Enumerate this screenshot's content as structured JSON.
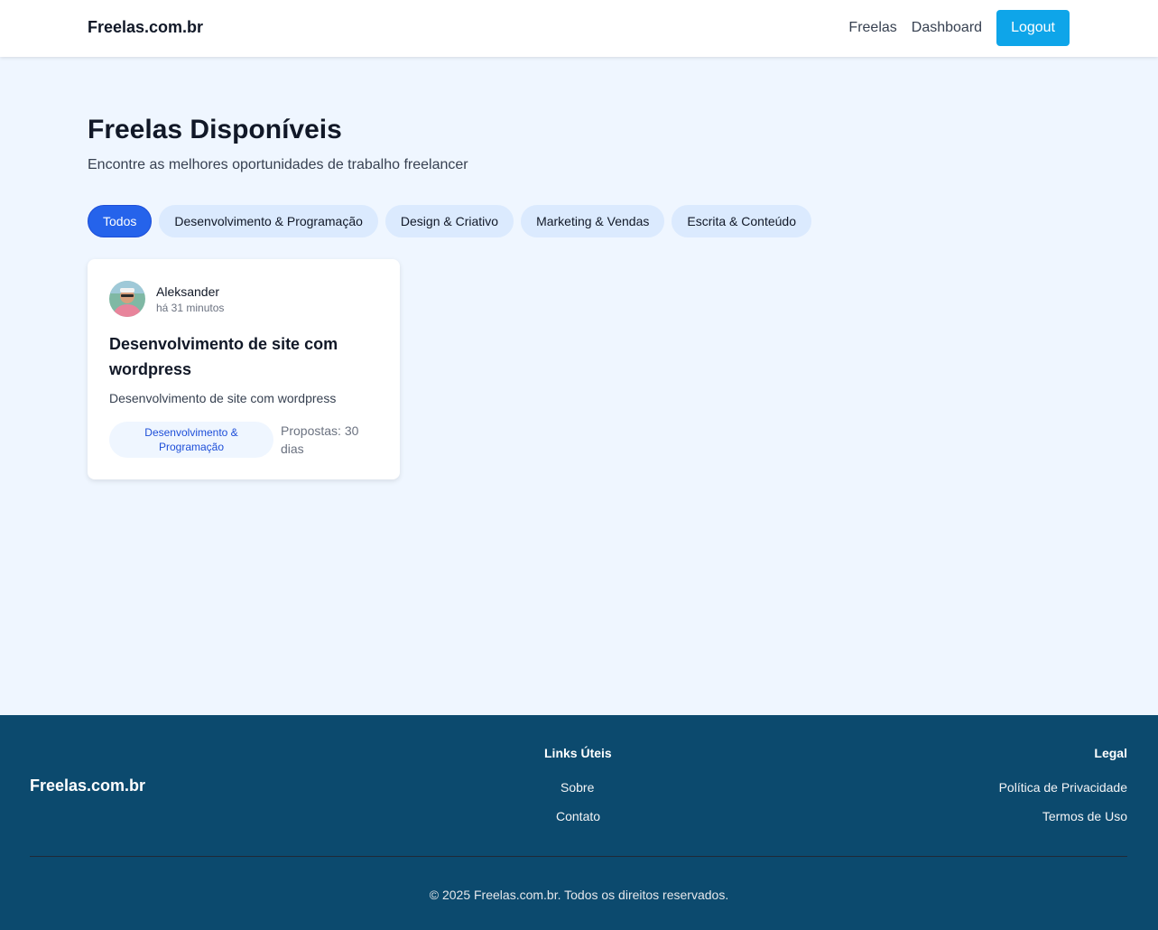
{
  "header": {
    "brand": "Freelas.com.br",
    "nav": [
      "Freelas",
      "Dashboard"
    ],
    "logout_label": "Logout"
  },
  "main": {
    "title": "Freelas Disponíveis",
    "subtitle": "Encontre as melhores oportunidades de trabalho freelancer",
    "filters": [
      {
        "label": "Todos",
        "active": true
      },
      {
        "label": "Desenvolvimento & Programação",
        "active": false
      },
      {
        "label": "Design & Criativo",
        "active": false
      },
      {
        "label": "Marketing & Vendas",
        "active": false
      },
      {
        "label": "Escrita & Conteúdo",
        "active": false
      }
    ],
    "cards": [
      {
        "author": "Aleksander",
        "time": "há 31 minutos",
        "title": "Desenvolvimento de site com wordpress",
        "description": "Desenvolvimento de site com wordpress",
        "category": "Desenvolvimento & Programação",
        "meta": "Propostas: 30 dias"
      }
    ]
  },
  "footer": {
    "brand": "Freelas.com.br",
    "links_title": "Links Úteis",
    "links": [
      "Sobre",
      "Contato"
    ],
    "legal_title": "Legal",
    "legal_links": [
      "Política de Privacidade",
      "Termos de Uso"
    ],
    "copyright": "© 2025 Freelas.com.br. Todos os direitos reservados."
  },
  "colors": {
    "accent": "#2563eb",
    "logout": "#0ea5e9",
    "footer_bg": "#0c4a6e",
    "page_bg": "#eff6ff"
  }
}
